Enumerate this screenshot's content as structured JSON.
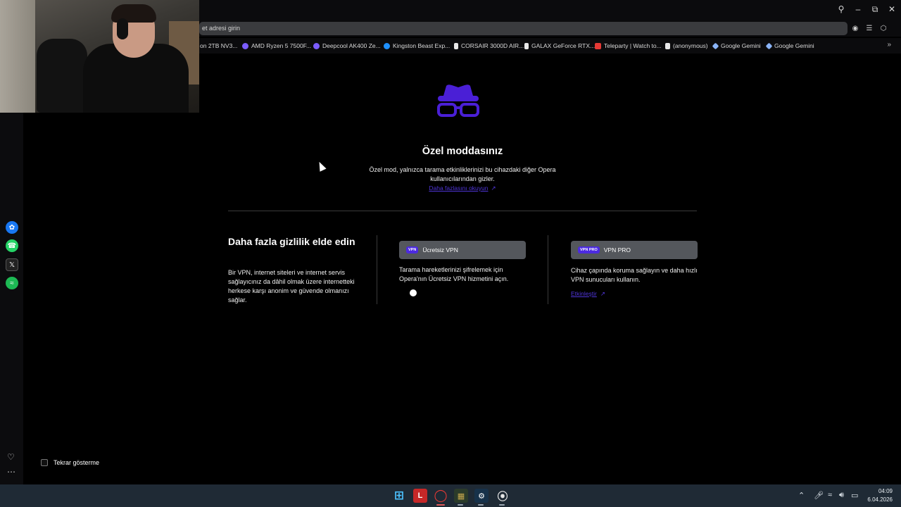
{
  "browser": {
    "address_placeholder": "et adresi girin",
    "bookmarks": [
      {
        "label": "on 2TB NV3...",
        "icon": "bookmark-icon",
        "color": "#444444"
      },
      {
        "label": "AMD Ryzen 5 7500F...",
        "icon": "shop-icon",
        "color": "#7b5cff"
      },
      {
        "label": "Deepcool AK400 Ze...",
        "icon": "shop-icon",
        "color": "#7b5cff"
      },
      {
        "label": "Kingston Beast Exp...",
        "icon": "check-icon",
        "color": "#1e90ff"
      },
      {
        "label": "CORSAIR 3000D AIR...",
        "icon": "corsair-icon",
        "color": "#e8e8e8"
      },
      {
        "label": "GALAX GeForce RTX...",
        "icon": "galax-icon",
        "color": "#e8e8e8"
      },
      {
        "label": "Teleparty | Watch to...",
        "icon": "teleparty-icon",
        "color": "#e53935"
      },
      {
        "label": "(anonymous)",
        "icon": "page-icon",
        "color": "#e8e8e8"
      },
      {
        "label": "Google Gemini",
        "icon": "gemini-icon",
        "color": "#8ab4f8"
      },
      {
        "label": "Google Gemini",
        "icon": "gemini-icon",
        "color": "#8ab4f8"
      }
    ]
  },
  "private": {
    "title": "Özel moddasınız",
    "description": "Özel mod, yalnızca tarama etkinliklerinizi bu cihazdaki diğer Opera kullanıcılarından gizler.",
    "learn_more": "Daha fazlasını okuyun",
    "more_heading": "Daha fazla gizlilik elde edin",
    "more_text": "Bir VPN, internet siteleri ve internet servis sağlayıcınız da dâhil olmak üzere internetteki herkese karşı anonim ve güvende olmanızı sağlar.",
    "free_vpn": {
      "badge": "VPN",
      "label": "Ücretsiz VPN",
      "text": "Tarama hareketlerinizi şifrelemek için Opera'nın Ücretsiz VPN hizmetini açın."
    },
    "pro_vpn": {
      "badge": "VPN PRO",
      "label": "VPN PRO",
      "text": "Cihaz çapında koruma sağlayın ve daha hızlı VPN sunucuları kullanın.",
      "link": "Etkinleştir"
    },
    "dont_show": "Tekrar gösterme",
    "accent_color": "#4c2ae0"
  },
  "taskbar": {
    "time": "04:09",
    "date": "6.04.2026"
  }
}
